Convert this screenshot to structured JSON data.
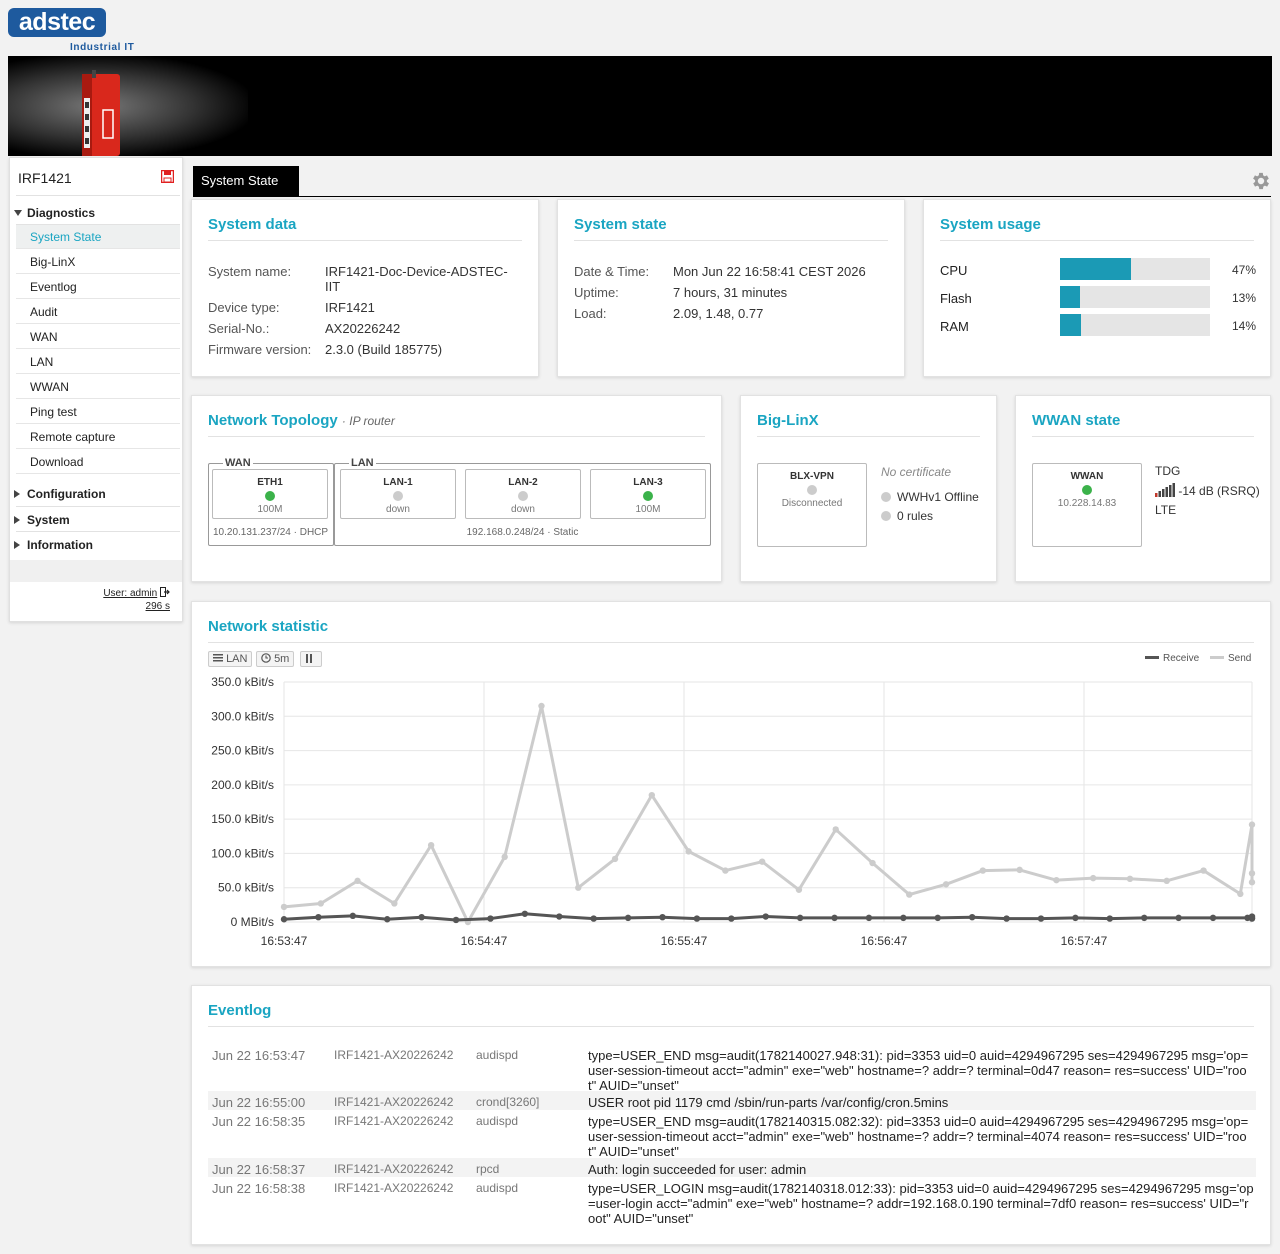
{
  "logo": {
    "word": "adstec",
    "subtitle": "Industrial IT"
  },
  "sidebar": {
    "device_name": "IRF1421",
    "groups": [
      {
        "label": "Diagnostics",
        "expanded": true
      },
      {
        "label": "Configuration",
        "expanded": false
      },
      {
        "label": "System",
        "expanded": false
      },
      {
        "label": "Information",
        "expanded": false
      }
    ],
    "items": [
      "System State",
      "Big-LinX",
      "Eventlog",
      "Audit",
      "WAN",
      "LAN",
      "WWAN",
      "Ping test",
      "Remote capture",
      "Download"
    ],
    "active_item": "System State",
    "user_label": "User: admin",
    "session_timeout": "296 s"
  },
  "tab": {
    "label": "System State"
  },
  "system_data": {
    "title": "System data",
    "labels": [
      "System name:",
      "Device type:",
      "Serial-No.:",
      "Firmware version:"
    ],
    "system_name": "IRF1421-Doc-Device-ADSTEC-IIT",
    "device_type": "IRF1421",
    "serial_no": "AX20226242",
    "firmware_version": "2.3.0 (Build 185775)"
  },
  "system_state": {
    "title": "System state",
    "labels": [
      "Date & Time:",
      "Uptime:",
      "Load:"
    ],
    "date_time": "Mon Jun 22 16:58:41 CEST 2026",
    "uptime": "7 hours, 31 minutes",
    "load": "2.09, 1.48, 0.77"
  },
  "system_usage": {
    "title": "System usage",
    "bars": [
      {
        "label": "CPU",
        "percent": 47,
        "text": "47%"
      },
      {
        "label": "Flash",
        "percent": 13,
        "text": "13%"
      },
      {
        "label": "RAM",
        "percent": 14,
        "text": "14%"
      }
    ],
    "color": "#1b9ab5"
  },
  "topology": {
    "title": "Network Topology",
    "subtitle": "· IP router",
    "wan": {
      "label": "WAN",
      "footer": "10.20.131.237/24 · DHCP",
      "ports": [
        {
          "name": "ETH1",
          "state": "100M",
          "up": true
        }
      ]
    },
    "lan": {
      "label": "LAN",
      "footer": "192.168.0.248/24 · Static",
      "ports": [
        {
          "name": "LAN-1",
          "state": "down",
          "up": false
        },
        {
          "name": "LAN-2",
          "state": "down",
          "up": false
        },
        {
          "name": "LAN-3",
          "state": "100M",
          "up": true
        }
      ]
    }
  },
  "biglinx": {
    "title": "Big-LinX",
    "port": {
      "name": "BLX-VPN",
      "state": "Disconnected",
      "up": false
    },
    "certificate": "No certificate",
    "offline": "WWHv1 Offline",
    "rules": "0 rules"
  },
  "wwan": {
    "title": "WWAN state",
    "port": {
      "name": "WWAN",
      "state": "10.228.14.83",
      "up": true
    },
    "operator": "TDG",
    "signal": "-14 dB (RSRQ)",
    "technology": "LTE"
  },
  "network_statistic": {
    "title": "Network statistic",
    "controls": {
      "interface": "LAN",
      "interval": "5m"
    },
    "legend": {
      "receive": "Receive",
      "send": "Send"
    }
  },
  "chart_data": {
    "type": "line",
    "x_ticks": [
      "16:53:47",
      "16:54:47",
      "16:55:47",
      "16:56:47",
      "16:57:47"
    ],
    "y_ticks": [
      "350.0 kBit/s",
      "300.0 kBit/s",
      "250.0 kBit/s",
      "200.0 kBit/s",
      "150.0 kBit/s",
      "100.0 kBit/s",
      "50.0 kBit/s",
      "0 MBit/s"
    ],
    "ylim": [
      0,
      350
    ],
    "x_seconds_from": "16:53:47",
    "x_step": 10,
    "series": [
      {
        "name": "Receive",
        "color": "#555555",
        "values": [
          4,
          7,
          9,
          4,
          7,
          3,
          5,
          12,
          8,
          5,
          6,
          7,
          5,
          5,
          8,
          6,
          6,
          6,
          6,
          6,
          7,
          5,
          5,
          6,
          5,
          6,
          6,
          6,
          6,
          5,
          6,
          8
        ]
      },
      {
        "name": "Send",
        "color": "#cccccc",
        "values": [
          22,
          27,
          60,
          27,
          112,
          0,
          95,
          315,
          50,
          92,
          185,
          103,
          75,
          88,
          47,
          135,
          86,
          40,
          55,
          75,
          76,
          61,
          64,
          63,
          60,
          75,
          41,
          142,
          71,
          58
        ]
      }
    ],
    "grid": true,
    "legend_position": "top-right"
  },
  "eventlog": {
    "title": "Eventlog",
    "rows": [
      {
        "date": "Jun 22 16:53:47",
        "host": "IRF1421-AX20226242",
        "proc": "audispd",
        "msg": "type=USER_END msg=audit(1782140027.948:31): pid=3353 uid=0 auid=4294967295 ses=4294967295 msg='op=user-session-timeout acct=\"admin\" exe=\"web\" hostname=? addr=? terminal=0d47 reason= res=success' UID=\"root\" AUID=\"unset\""
      },
      {
        "date": "Jun 22 16:55:00",
        "host": "IRF1421-AX20226242",
        "proc": "crond[3260]",
        "msg": "USER root pid 1179 cmd /sbin/run-parts /var/config/cron.5mins"
      },
      {
        "date": "Jun 22 16:58:35",
        "host": "IRF1421-AX20226242",
        "proc": "audispd",
        "msg": "type=USER_END msg=audit(1782140315.082:32): pid=3353 uid=0 auid=4294967295 ses=4294967295 msg='op=user-session-timeout acct=\"admin\" exe=\"web\" hostname=? addr=? terminal=4074 reason= res=success' UID=\"root\" AUID=\"unset\""
      },
      {
        "date": "Jun 22 16:58:37",
        "host": "IRF1421-AX20226242",
        "proc": "rpcd",
        "msg": "Auth: login succeeded for user: admin"
      },
      {
        "date": "Jun 22 16:58:38",
        "host": "IRF1421-AX20226242",
        "proc": "audispd",
        "msg": "type=USER_LOGIN msg=audit(1782140318.012:33): pid=3353 uid=0 auid=4294967295 ses=4294967295 msg='op=user-login acct=\"admin\" exe=\"web\" hostname=? addr=192.168.0.190 terminal=7df0 reason= res=success' UID=\"root\" AUID=\"unset\""
      }
    ]
  }
}
